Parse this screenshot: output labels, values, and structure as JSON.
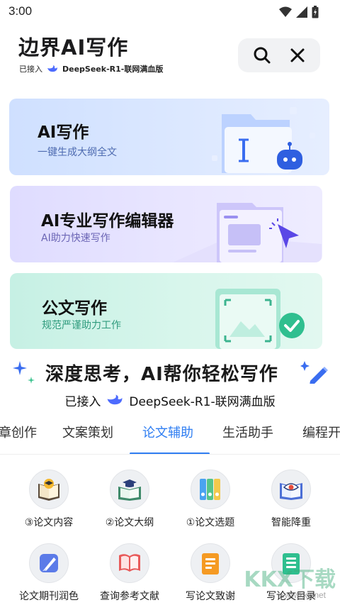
{
  "status": {
    "time": "3:00"
  },
  "header": {
    "title": "边界AI写作",
    "sub_prefix": "已接入",
    "sub_model": "DeepSeek-R1-联网满血版"
  },
  "cards": [
    {
      "title": "AI写作",
      "desc": "一键生成大纲全文"
    },
    {
      "title": "AI专业写作编辑器",
      "desc": "AI助力快速写作"
    },
    {
      "title": "公文写作",
      "desc": "规范严谨助力工作"
    }
  ],
  "slogan": {
    "text": "深度思考，AI帮你轻松写作",
    "sub_prefix": "已接入",
    "sub_model": "DeepSeek-R1-联网满血版"
  },
  "tabs": [
    {
      "label": "章创作",
      "active": false
    },
    {
      "label": "文案策划",
      "active": false
    },
    {
      "label": "论文辅助",
      "active": true
    },
    {
      "label": "生活助手",
      "active": false
    },
    {
      "label": "编程开",
      "active": false
    }
  ],
  "grid": [
    {
      "label": "③论文内容",
      "icon": "book-graduation-icon"
    },
    {
      "label": "②论文大纲",
      "icon": "book-cap-icon"
    },
    {
      "label": "①论文选题",
      "icon": "binders-icon"
    },
    {
      "label": "智能降重",
      "icon": "eye-book-icon"
    },
    {
      "label": "论文期刊润色",
      "icon": "brush-icon"
    },
    {
      "label": "查询参考文献",
      "icon": "open-book-icon"
    },
    {
      "label": "写论文致谢",
      "icon": "notepad-icon"
    },
    {
      "label": "写论文目录",
      "icon": "list-doc-icon"
    }
  ],
  "watermark": {
    "brand": "KKX下载",
    "url": "www.kkx.net"
  },
  "colors": {
    "accent": "#2f7ef2"
  }
}
